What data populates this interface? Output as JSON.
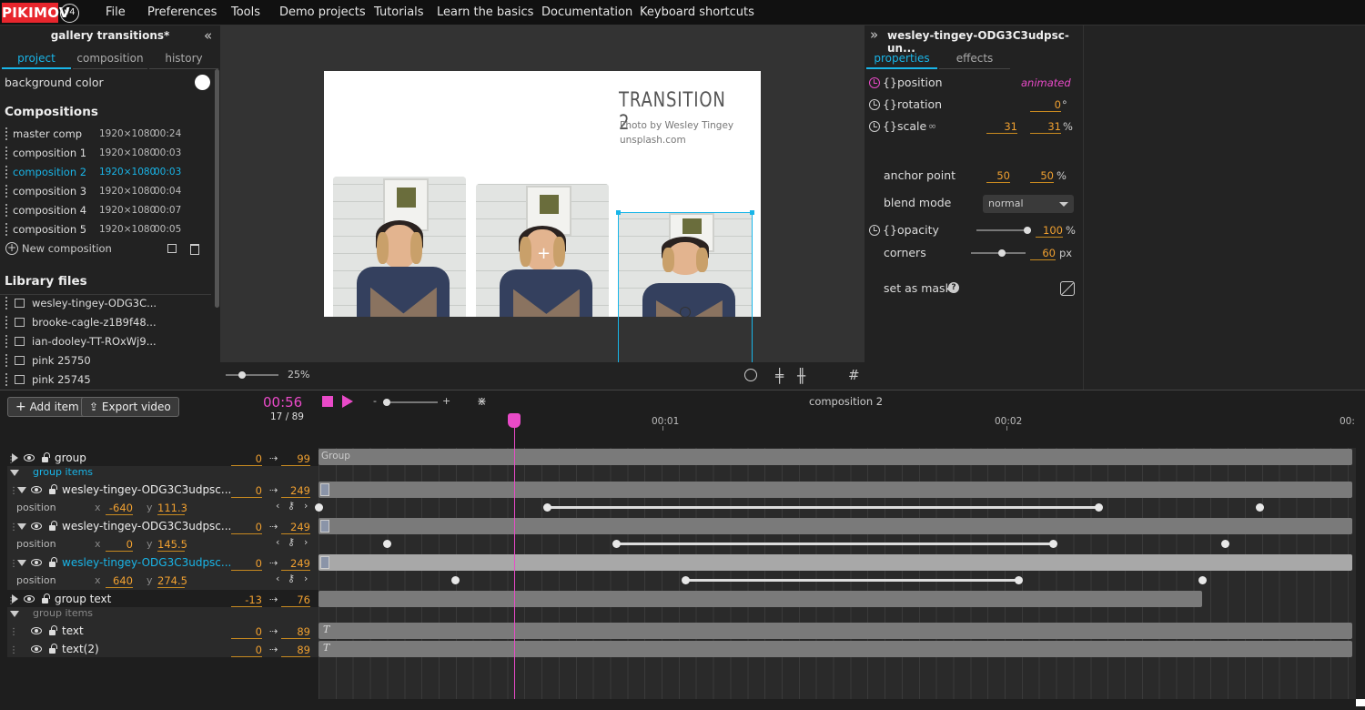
{
  "menubar": {
    "logo": "PIKIMOV",
    "version": "v4",
    "items": [
      "File",
      "Preferences",
      "Tools",
      "Demo projects",
      "Tutorials",
      "Learn the basics",
      "Documentation",
      "Keyboard shortcuts"
    ]
  },
  "left_panel": {
    "title": "gallery transitions*",
    "tabs": [
      "project",
      "composition",
      "history"
    ],
    "background_color_label": "background color",
    "compositions_heading": "Compositions",
    "compositions": [
      {
        "name": "master comp",
        "size": "1920×1080",
        "duration": "00:24"
      },
      {
        "name": "composition 1",
        "size": "1920×1080",
        "duration": "00:03"
      },
      {
        "name": "composition 2",
        "size": "1920×1080",
        "duration": "00:03"
      },
      {
        "name": "composition 3",
        "size": "1920×1080",
        "duration": "00:04"
      },
      {
        "name": "composition 4",
        "size": "1920×1080",
        "duration": "00:07"
      },
      {
        "name": "composition 5",
        "size": "1920×1080",
        "duration": "00:05"
      }
    ],
    "new_composition": "New composition",
    "library_heading": "Library files",
    "library": [
      "wesley-tingey-ODG3C...",
      "brooke-cagle-z1B9f48...",
      "ian-dooley-TT-ROxWj9...",
      "pink 25750",
      "pink 25745"
    ]
  },
  "canvas": {
    "title": "TRANSITION 2",
    "credit1": "Photo by Wesley Tingey",
    "credit2": "unsplash.com",
    "zoom": "25%",
    "zoom_value": 0.25
  },
  "right_panel": {
    "title": "wesley-tingey-ODG3C3udpsc-un...",
    "tabs": [
      "properties",
      "effects"
    ],
    "position_label": "position",
    "position_status": "animated",
    "rotation_label": "rotation",
    "rotation_value": "0",
    "rotation_unit": "°",
    "scale_label": "scale",
    "scale_x": "31",
    "scale_y": "31",
    "scale_unit": "%",
    "anchor_label": "anchor point",
    "anchor_x": "50",
    "anchor_y": "50",
    "anchor_unit": "%",
    "blend_label": "blend mode",
    "blend_value": "normal",
    "opacity_label": "opacity",
    "opacity_value": "100",
    "opacity_unit": "%",
    "corners_label": "corners",
    "corners_value": "60",
    "corners_unit": "px",
    "mask_label": "set as mask"
  },
  "timeline": {
    "add_item": "Add item",
    "export_video": "Export video",
    "time": "00:56",
    "frame": "17 / 89",
    "composition": "composition 2",
    "ruler": [
      "00:01",
      "00:02",
      "00:"
    ],
    "rows": {
      "group": {
        "name": "group",
        "start": "0",
        "end": "99",
        "bar": "Group"
      },
      "group_items": "group items",
      "l1": {
        "name": "wesley-tingey-ODG3C3udpsc...",
        "start": "0",
        "end": "249",
        "prop": "position",
        "x": "-640",
        "y": "111.3"
      },
      "l2": {
        "name": "wesley-tingey-ODG3C3udpsc...",
        "start": "0",
        "end": "249",
        "prop": "position",
        "x": "0",
        "y": "145.5"
      },
      "l3": {
        "name": "wesley-tingey-ODG3C3udpsc...",
        "start": "0",
        "end": "249",
        "prop": "position",
        "x": "640",
        "y": "274.5"
      },
      "group_text": {
        "name": "group text",
        "start": "-13",
        "end": "76"
      },
      "group_items2": "group items",
      "text": {
        "name": "text",
        "start": "0",
        "end": "89"
      },
      "text2": {
        "name": "text(2)",
        "start": "0",
        "end": "89"
      }
    },
    "x_label": "x",
    "y_label": "y",
    "arrow": "⇢",
    "minus": "-",
    "plus": "+"
  },
  "colors": {
    "accent": "#19b5e8",
    "keyframe": "#e94ac8",
    "value": "#f0a030",
    "logo": "#e8262d"
  }
}
